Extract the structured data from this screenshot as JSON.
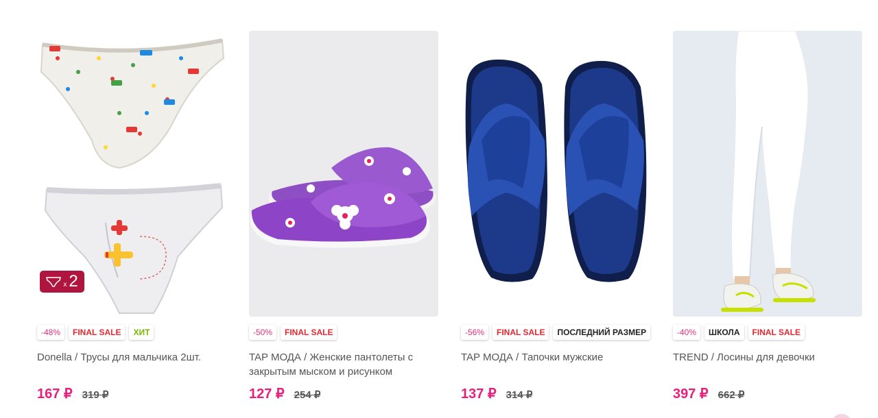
{
  "products": [
    {
      "badges": [
        "-48%",
        "FINAL SALE",
        "ХИТ"
      ],
      "pack_count": "2",
      "pack_multiplier": "x",
      "title": "Donella / Трусы для мальчика 2шт.",
      "price": "167 ₽",
      "old_price": "319 ₽"
    },
    {
      "badges": [
        "-50%",
        "FINAL SALE"
      ],
      "title": "TAP МОДА / Женские пантолеты с закрытым мыском и рисунком",
      "price": "127 ₽",
      "old_price": "254 ₽"
    },
    {
      "badges": [
        "-56%",
        "FINAL SALE",
        "ПОСЛЕДНИЙ РАЗМЕР"
      ],
      "title": "TAP МОДА / Тапочки мужские",
      "price": "137 ₽",
      "old_price": "314 ₽"
    },
    {
      "badges": [
        "-40%",
        "ШКОЛА",
        "FINAL SALE"
      ],
      "title": "TREND / Лосины для девочки",
      "price": "397 ₽",
      "old_price": "662 ₽"
    }
  ],
  "colors": {
    "price_accent": "#e91e7c",
    "final_sale": "#e8262e",
    "hit": "#7ab800",
    "pack_badge": "#b0153f"
  }
}
